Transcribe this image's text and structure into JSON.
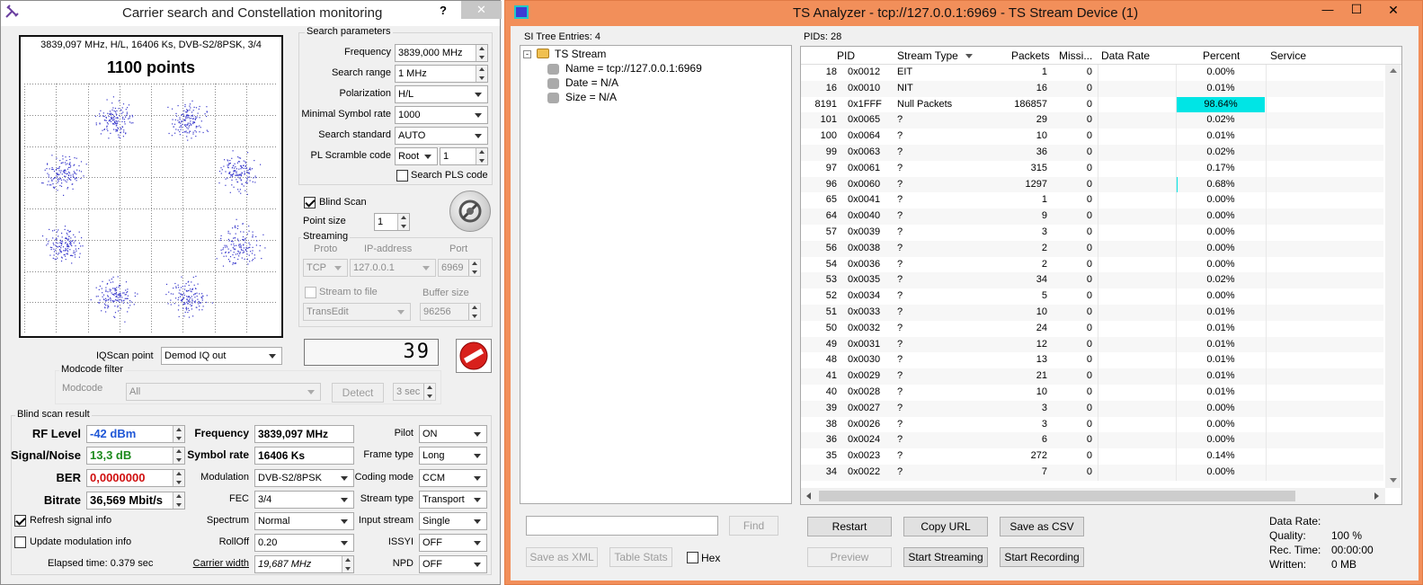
{
  "left": {
    "title": "Carrier search and Constellation monitoring",
    "help": "?",
    "close": "✕",
    "constellation": {
      "info": "3839,097 MHz, H/L, 16406 Ks, DVB-S2/8PSK, 3/4",
      "points": "1100 points"
    },
    "search": {
      "group": "Search parameters",
      "frequency_label": "Frequency",
      "frequency": "3839,000 MHz",
      "range_label": "Search range",
      "range": "1 MHz",
      "pol_label": "Polarization",
      "pol": "H/L",
      "msr_label": "Minimal Symbol rate",
      "msr": "1000",
      "std_label": "Search standard",
      "std": "AUTO",
      "pls_label": "PL Scramble code",
      "pls_mode": "Root",
      "pls_value": "1",
      "search_pls": "Search PLS code"
    },
    "blind_scan": "Blind Scan",
    "point_size_label": "Point size",
    "point_size": "1",
    "streaming": {
      "group": "Streaming",
      "proto_h": "Proto",
      "ip_h": "IP-address",
      "port_h": "Port",
      "proto": "TCP",
      "ip": "127.0.0.1",
      "port": "6969",
      "stream_to_file": "Stream to file",
      "buffer_h": "Buffer size",
      "plugin": "TransEdit",
      "buffer": "96256"
    },
    "iq_label": "IQScan point",
    "iq": "Demod IQ out",
    "counter": "39",
    "modcode": {
      "group": "Modcode filter",
      "label": "Modcode",
      "value": "All",
      "detect": "Detect",
      "interval": "3 sec"
    },
    "result": {
      "group": "Blind scan result",
      "rf_label": "RF Level",
      "rf": "-42 dBm",
      "sn_label": "Signal/Noise",
      "sn": "13,3 dB",
      "ber_label": "BER",
      "ber": "0,0000000",
      "bitrate_label": "Bitrate",
      "bitrate": "36,569 Mbit/s",
      "freq_label": "Frequency",
      "freq": "3839,097 MHz",
      "sr_label": "Symbol rate",
      "sr": "16406 Ks",
      "mod_label": "Modulation",
      "mod": "DVB-S2/8PSK",
      "fec_label": "FEC",
      "fec": "3/4",
      "spectrum_label": "Spectrum",
      "spectrum": "Normal",
      "rolloff_label": "RollOff",
      "rolloff": "0.20",
      "cw_label": "Carrier width",
      "cw": "19,687 MHz",
      "pilot_label": "Pilot",
      "pilot": "ON",
      "frame_label": "Frame type",
      "frame": "Long",
      "coding_label": "Coding mode",
      "coding": "CCM",
      "stype_label": "Stream type",
      "stype": "Transport",
      "istream_label": "Input stream",
      "istream": "Single",
      "issyi_label": "ISSYI",
      "issyi": "OFF",
      "npd_label": "NPD",
      "npd": "OFF",
      "refresh": "Refresh signal info",
      "update_mod": "Update modulation info",
      "elapsed": "Elapsed time: 0.379 sec"
    }
  },
  "right": {
    "title": "TS Analyzer - tcp://127.0.0.1:6969 - TS Stream Device (1)",
    "min": "—",
    "max": "☐",
    "close": "✕",
    "si_header": "SI Tree Entries: 4",
    "tree_root": "TS Stream",
    "tree_items": [
      "Name = tcp://127.0.0.1:6969",
      "Date = N/A",
      "Size = N/A"
    ],
    "find": "Find",
    "save_xml": "Save as XML",
    "table_stats": "Table Stats",
    "hex": "Hex",
    "pids_header": "PIDs: 28",
    "columns": [
      "PID",
      "Stream Type",
      "Packets",
      "Missi...",
      "Data Rate",
      "Percent",
      "Service"
    ],
    "rows": [
      [
        "18",
        "0x0012",
        "EIT",
        "1",
        "0",
        "0.00%"
      ],
      [
        "16",
        "0x0010",
        "NIT",
        "16",
        "0",
        "0.01%"
      ],
      [
        "8191",
        "0x1FFF",
        "Null Packets",
        "186857",
        "0",
        "98.64%"
      ],
      [
        "101",
        "0x0065",
        "?",
        "29",
        "0",
        "0.02%"
      ],
      [
        "100",
        "0x0064",
        "?",
        "10",
        "0",
        "0.01%"
      ],
      [
        "99",
        "0x0063",
        "?",
        "36",
        "0",
        "0.02%"
      ],
      [
        "97",
        "0x0061",
        "?",
        "315",
        "0",
        "0.17%"
      ],
      [
        "96",
        "0x0060",
        "?",
        "1297",
        "0",
        "0.68%"
      ],
      [
        "65",
        "0x0041",
        "?",
        "1",
        "0",
        "0.00%"
      ],
      [
        "64",
        "0x0040",
        "?",
        "9",
        "0",
        "0.00%"
      ],
      [
        "57",
        "0x0039",
        "?",
        "3",
        "0",
        "0.00%"
      ],
      [
        "56",
        "0x0038",
        "?",
        "2",
        "0",
        "0.00%"
      ],
      [
        "54",
        "0x0036",
        "?",
        "2",
        "0",
        "0.00%"
      ],
      [
        "53",
        "0x0035",
        "?",
        "34",
        "0",
        "0.02%"
      ],
      [
        "52",
        "0x0034",
        "?",
        "5",
        "0",
        "0.00%"
      ],
      [
        "51",
        "0x0033",
        "?",
        "10",
        "0",
        "0.01%"
      ],
      [
        "50",
        "0x0032",
        "?",
        "24",
        "0",
        "0.01%"
      ],
      [
        "49",
        "0x0031",
        "?",
        "12",
        "0",
        "0.01%"
      ],
      [
        "48",
        "0x0030",
        "?",
        "13",
        "0",
        "0.01%"
      ],
      [
        "41",
        "0x0029",
        "?",
        "21",
        "0",
        "0.01%"
      ],
      [
        "40",
        "0x0028",
        "?",
        "10",
        "0",
        "0.01%"
      ],
      [
        "39",
        "0x0027",
        "?",
        "3",
        "0",
        "0.00%"
      ],
      [
        "38",
        "0x0026",
        "?",
        "3",
        "0",
        "0.00%"
      ],
      [
        "36",
        "0x0024",
        "?",
        "6",
        "0",
        "0.00%"
      ],
      [
        "35",
        "0x0023",
        "?",
        "272",
        "0",
        "0.14%"
      ],
      [
        "34",
        "0x0022",
        "?",
        "7",
        "0",
        "0.00%"
      ]
    ],
    "restart": "Restart",
    "copy_url": "Copy URL",
    "save_csv": "Save as CSV",
    "preview": "Preview",
    "start_streaming": "Start Streaming",
    "start_recording": "Start Recording",
    "stats_labels": [
      "Data Rate:",
      "Quality:",
      "Rec. Time:",
      "Written:"
    ],
    "stats_values": [
      "",
      "100 %",
      "00:00:00",
      "0 MB"
    ],
    "percent_color": "#00e5e5"
  }
}
